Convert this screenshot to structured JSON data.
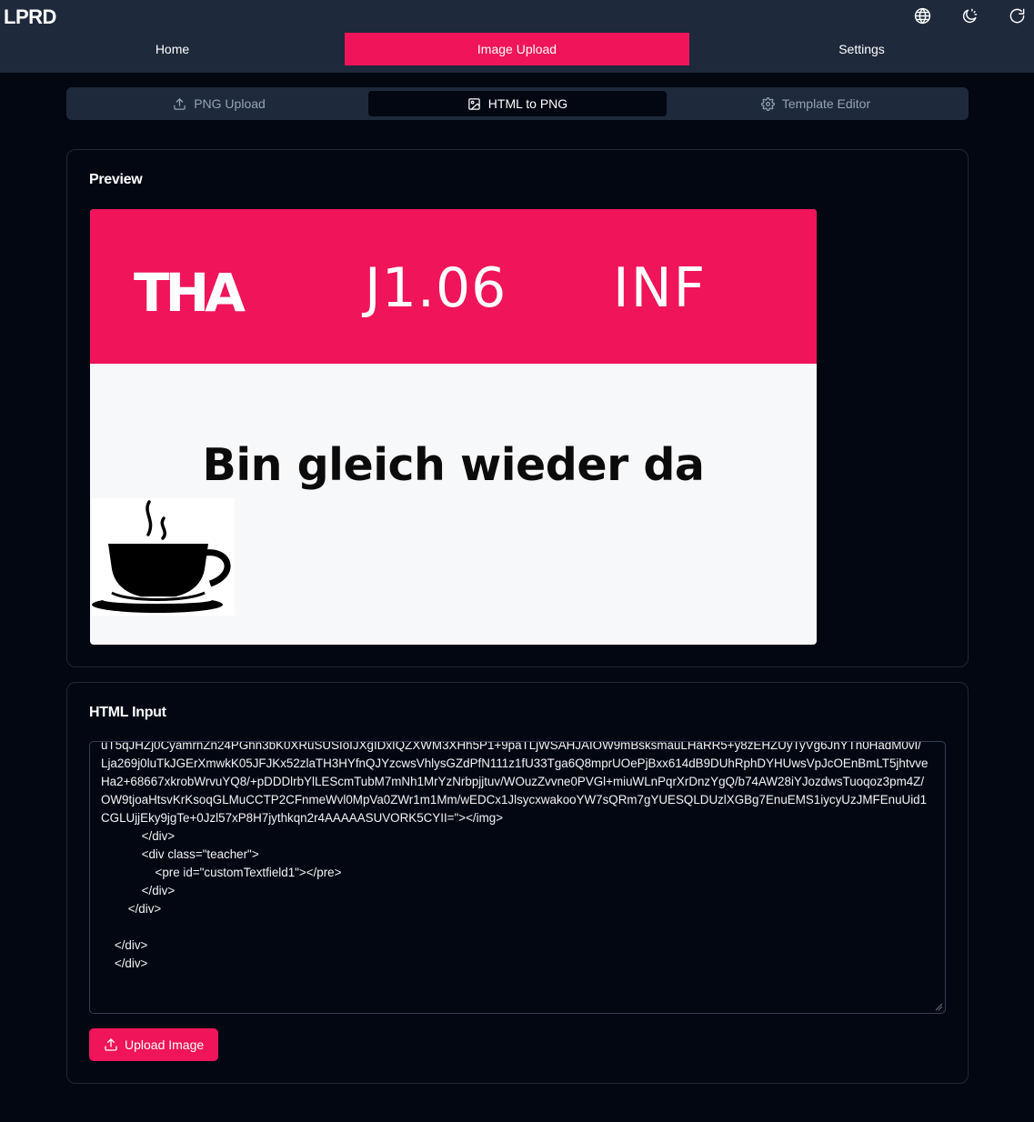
{
  "app": {
    "brand": "LPRD"
  },
  "header": {
    "icons": [
      "globe-icon",
      "moon-sun-icon",
      "refresh-icon"
    ],
    "nav": [
      {
        "label": "Home",
        "active": false
      },
      {
        "label": "Image Upload",
        "active": true
      },
      {
        "label": "Settings",
        "active": false
      }
    ]
  },
  "subtabs": [
    {
      "label": "PNG Upload",
      "icon": "upload-icon",
      "active": false
    },
    {
      "label": "HTML to PNG",
      "icon": "image-icon",
      "active": true
    },
    {
      "label": "Template Editor",
      "icon": "gear-icon",
      "active": false
    }
  ],
  "preview": {
    "title": "Preview",
    "logo_text": "THA",
    "room": "J1.06",
    "department": "INF",
    "status": "Bin gleich wieder da",
    "image_icon": "coffee-cup-icon"
  },
  "html_input": {
    "title": "HTML Input",
    "code": "uT5qJHZj0CyamrnZn24PGhn3bK0XRuSUSIoIJXgIDxIQZXWM3XHh5P1+9paTLjWSAHJAIOW9mBsksmauLHaRR5+y8zEHZUyTyVg6JnYTn0HadM0vI/\nLja269j0luTkJGErXmwkK05JFJKx52zlaTH3HYfnQJYzcwsVhlysGZdPfN111z1fU33Tga6Q8mprUOePjBxx614dB9DUhRphDYHUwsVpJcOEnBmLT5jhtvveHa2+68667xkrobWrvuYQ8/+pDDDlrbYlLEScmTubM7mNh1MrYzNrbpjjtuv/WOuzZvvne0PVGl+miuWLnPqrXrDnzYgQ/b74AW28iYJozdwsTuoqoz3pm4Z/OW9tjoaHtsvKrKsoqGLMuCCTP2CFnmeWvl0MpVa0ZWr1m1Mm/wEDCx1JlsycxwakooYW7sQRm7gYUESQLDUzlXGBg7EnuEMS1iycyUzJMFEnuUid1CGLUjjEky9jgTe+0Jzl57xP8H7jythkqn2r4AAAAASUVORK5CYII=\"></img>\n            </div>\n            <div class=\"teacher\">\n                <pre id=\"customTextfield1\"></pre>\n            </div>\n        </div>\n\n    </div>\n    </div>",
    "upload_label": "Upload Image"
  }
}
